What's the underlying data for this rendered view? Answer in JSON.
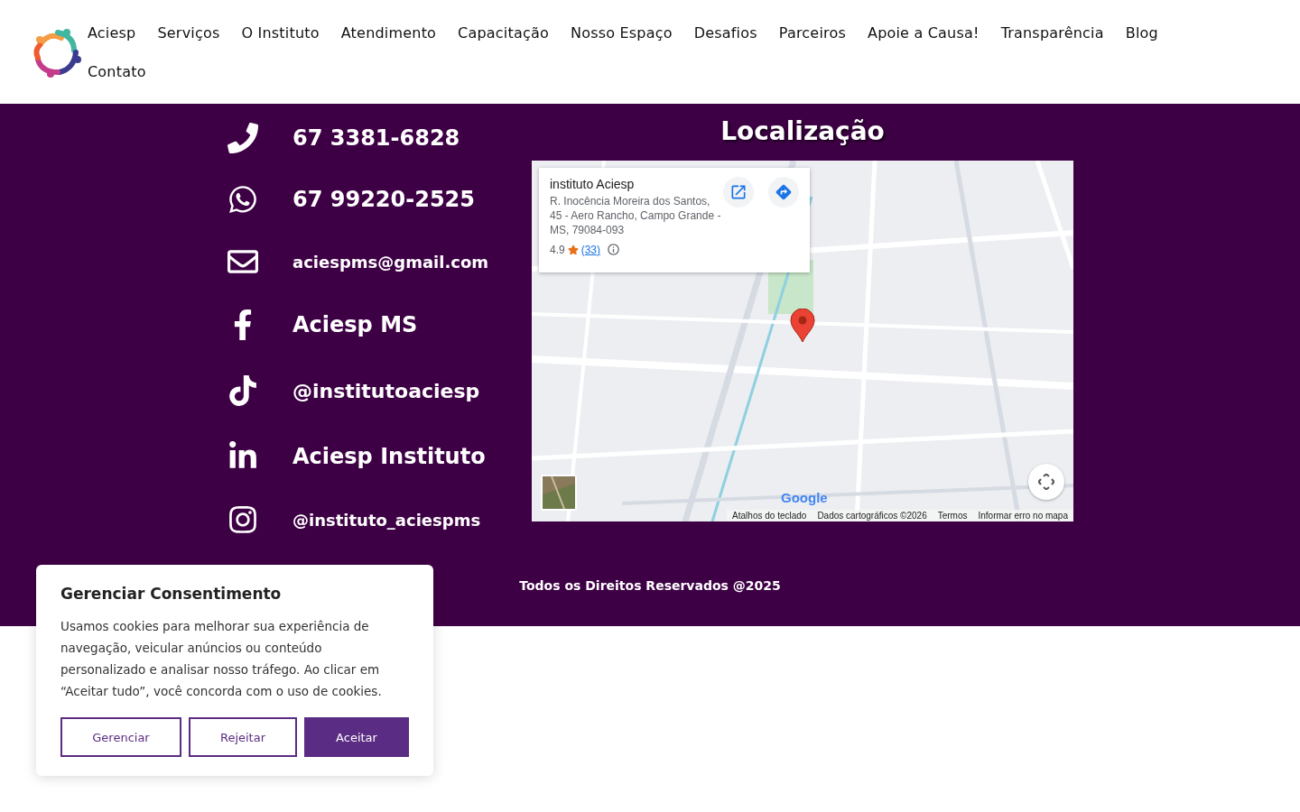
{
  "nav": {
    "items": [
      {
        "label": "Aciesp"
      },
      {
        "label": "Serviços"
      },
      {
        "label": "O Instituto"
      },
      {
        "label": "Atendimento"
      },
      {
        "label": "Capacitação"
      },
      {
        "label": "Nosso Espaço"
      },
      {
        "label": "Desafios"
      },
      {
        "label": "Parceiros"
      },
      {
        "label": "Apoie a Causa!"
      },
      {
        "label": "Transparência"
      },
      {
        "label": "Blog"
      },
      {
        "label": "Contato"
      }
    ]
  },
  "contacts": [
    {
      "kind": "phone",
      "text": "67 3381-6828"
    },
    {
      "kind": "whatsapp",
      "text": "67 99220-2525"
    },
    {
      "kind": "email",
      "text": "aciespms@gmail.com"
    },
    {
      "kind": "facebook",
      "text": "Aciesp MS"
    },
    {
      "kind": "tiktok",
      "text": "@institutoaciesp"
    },
    {
      "kind": "linkedin",
      "text": "Aciesp Instituto"
    },
    {
      "kind": "instagram",
      "text": "@instituto_aciespms"
    }
  ],
  "location": {
    "title": "Localização",
    "map": {
      "kind": "picture",
      "place_card": {
        "name": "instituto Aciesp",
        "address": "R. Inocência Moreira dos Santos, 45 - Aero Rancho, Campo Grande - MS, 79084-093",
        "rating": "4.9",
        "reviews": "(33)"
      },
      "logo": "Google",
      "attribution": [
        "Atalhos do teclado",
        "Dados cartográficos ©2026",
        "Termos",
        "Informar erro no mapa"
      ]
    }
  },
  "footer": {
    "copyright": "Todos os Direitos Reservados @2025"
  },
  "cookie_dialog": {
    "title": "Gerenciar Consentimento",
    "body": "Usamos cookies para melhorar sua experiência de navegação, veicular anúncios ou conteúdo personalizado e analisar nosso tráfego. Ao clicar em “Aceitar tudo”, você concorda com o uso de cookies.",
    "buttons": [
      {
        "label": "Gerenciar",
        "kind": "outline"
      },
      {
        "label": "Rejeitar",
        "kind": "outline"
      },
      {
        "label": "Aceitar",
        "kind": "primary"
      }
    ]
  }
}
